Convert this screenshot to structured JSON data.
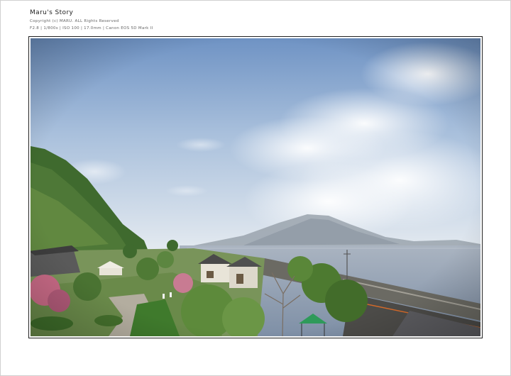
{
  "header": {
    "title": "Maru's Story",
    "copyright": "Copyright (c) MARU. ALL Rights Reserved",
    "exif": "F2.8 | 1/800s | ISO 100 | 17.0mm | Canon EOS 5D Mark II"
  },
  "photo": {
    "subject": "coastal-garden-with-volcano"
  },
  "colors": {
    "sky_top": "#6f93c4",
    "sky_bottom": "#dfe7ee",
    "sea": "#8d9db1",
    "mountain": "#9aa3ad",
    "foliage": "#3f6a2e"
  }
}
